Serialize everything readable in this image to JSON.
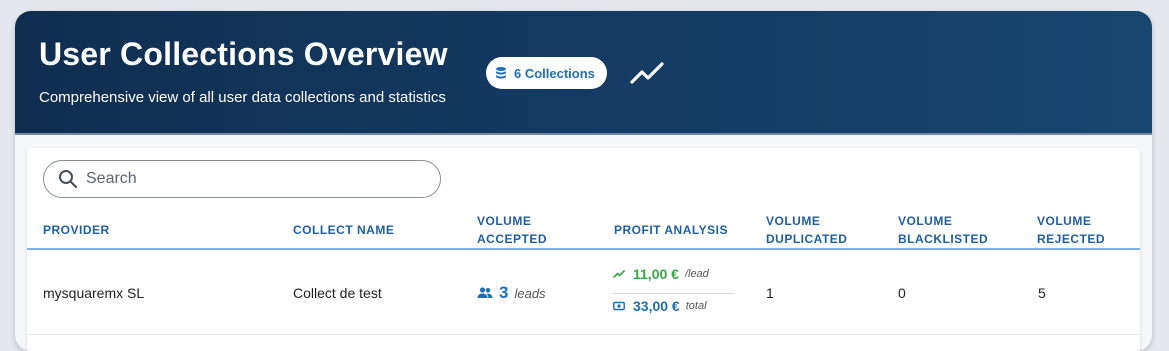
{
  "header": {
    "title": "User Collections Overview",
    "subtitle": "Comprehensive view of all user data collections and statistics",
    "badge_label": "6 Collections",
    "badge_icon": "database-icon",
    "trend_icon": "trending-up-icon"
  },
  "search": {
    "placeholder": "Search",
    "value": ""
  },
  "table": {
    "columns": [
      {
        "key": "provider",
        "line1": "PROVIDER",
        "line2": ""
      },
      {
        "key": "collect_name",
        "line1": "COLLECT NAME",
        "line2": ""
      },
      {
        "key": "volume_accepted",
        "line1": "VOLUME",
        "line2": "ACCEPTED"
      },
      {
        "key": "profit_analysis",
        "line1": "PROFIT ANALYSIS",
        "line2": ""
      },
      {
        "key": "volume_duplicated",
        "line1": "VOLUME",
        "line2": "DUPLICATED"
      },
      {
        "key": "volume_blacklisted",
        "line1": "VOLUME",
        "line2": "BLACKLISTED"
      },
      {
        "key": "volume_rejected",
        "line1": "VOLUME",
        "line2": "REJECTED"
      }
    ],
    "rows": [
      {
        "provider": "mysquaremx SL",
        "collect_name": "Collect de test",
        "volume_accepted": {
          "value": "3",
          "unit": "leads",
          "icon": "people-icon"
        },
        "profit": {
          "per_lead": "11,00 €",
          "per_lead_suffix": "/lead",
          "per_lead_icon": "trending-up-icon",
          "total": "33,00 €",
          "total_suffix": "total",
          "total_icon": "money-icon"
        },
        "volume_duplicated": "1",
        "volume_blacklisted": "0",
        "volume_rejected": "5"
      }
    ]
  },
  "colors": {
    "header_bg": "#143d66",
    "accent_blue": "#1f6fb8",
    "profit_green": "#3aa648",
    "header_text_blue": "#1f5f9e"
  }
}
